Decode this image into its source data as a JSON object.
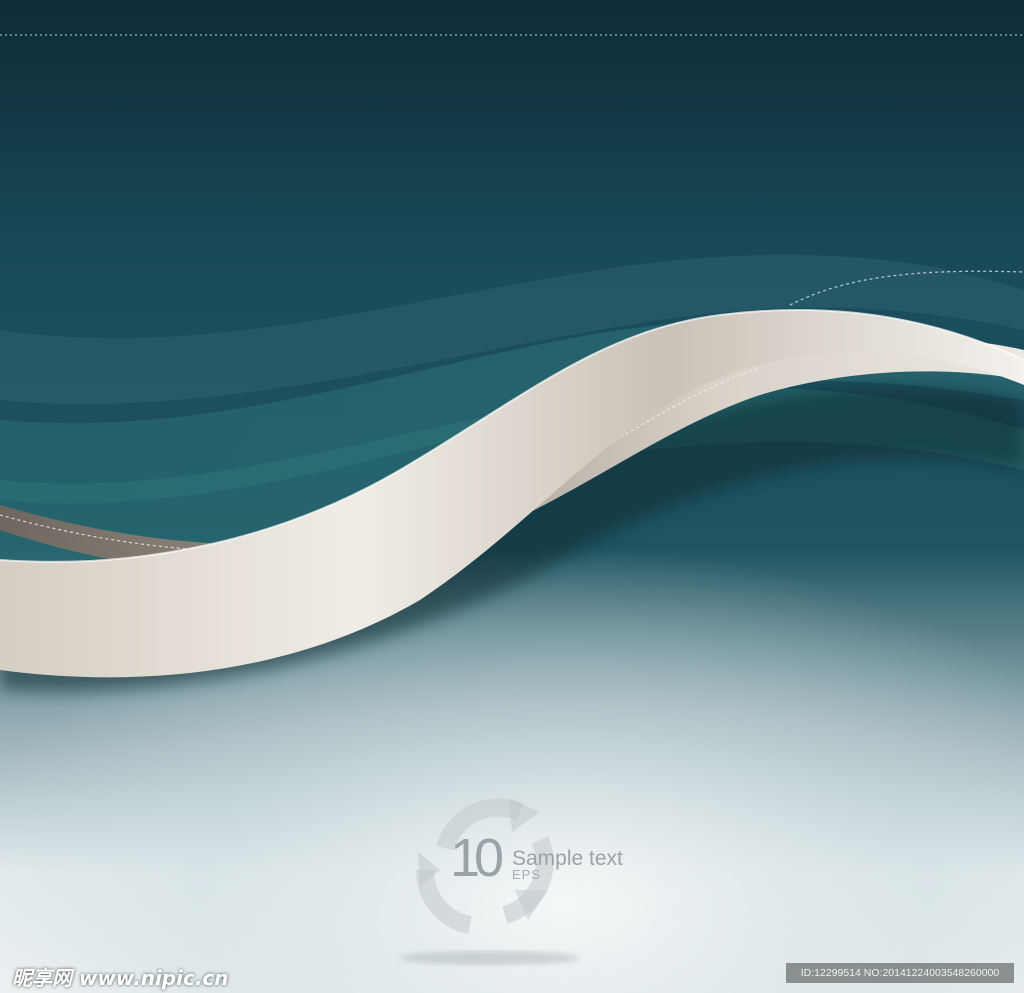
{
  "logo": {
    "number": "10",
    "format": "EPS",
    "caption": "Sample text"
  },
  "watermark": {
    "left_text": "昵享网 www.nipic.cn",
    "right_text": "ID:12299514 NO:20141224003548260000"
  },
  "colors": {
    "top_dark": "#0e2c38",
    "mid_teal": "#1e5463",
    "ribbon_light": "#ece7de",
    "ribbon_shadow": "#8d867d",
    "bottom_light": "#e9eff1"
  }
}
